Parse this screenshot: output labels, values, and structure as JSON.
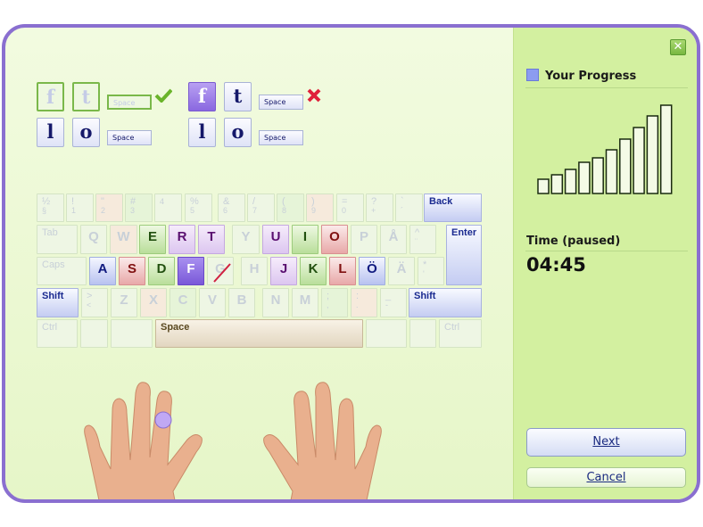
{
  "exercise": {
    "completed": {
      "row1": [
        "f",
        "t"
      ],
      "row1_space": "Space",
      "row2": [
        "l",
        "o"
      ],
      "row2_space": "Space",
      "status_icon": "checkmark-icon",
      "status_color": "#6ab42a"
    },
    "current": {
      "row1": [
        "f",
        "t"
      ],
      "row1_space": "Space",
      "row2": [
        "l",
        "o"
      ],
      "row2_space": "Space",
      "status_icon": "x-mark-icon",
      "status_color": "#e0203a"
    }
  },
  "keyboard": {
    "rows": [
      [
        {
          "t": "½",
          "s": "§",
          "c": "f"
        },
        {
          "t": "!",
          "s": "1",
          "c": "f"
        },
        {
          "t": "\"",
          "s": "2",
          "c": "f-pink"
        },
        {
          "t": "#",
          "s": "3",
          "c": "f-green"
        },
        {
          "t": "",
          "s": "4",
          "c": "f"
        },
        {
          "t": "%",
          "s": "5",
          "c": "f"
        },
        {
          "t": "&",
          "s": "6",
          "c": "f"
        },
        {
          "t": "/",
          "s": "7",
          "c": "f"
        },
        {
          "t": "(",
          "s": "8",
          "c": "f-green"
        },
        {
          "t": ")",
          "s": "9",
          "c": "f-pink"
        },
        {
          "t": "=",
          "s": "0",
          "c": "f"
        },
        {
          "t": "?",
          "s": "+",
          "c": "f"
        },
        {
          "t": "`",
          "s": "´",
          "c": "f"
        },
        {
          "t": "Back",
          "s": "",
          "c": "special"
        }
      ],
      [
        {
          "t": "Tab",
          "c": "f"
        },
        {
          "t": "Q",
          "c": "f",
          "l": 1
        },
        {
          "t": "W",
          "c": "f-pink",
          "l": 1
        },
        {
          "t": "E",
          "c": "green",
          "l": 1
        },
        {
          "t": "R",
          "c": "purple",
          "l": 1
        },
        {
          "t": "T",
          "c": "purple",
          "l": 1
        },
        {
          "t": "Y",
          "c": "f",
          "l": 1
        },
        {
          "t": "U",
          "c": "purple",
          "l": 1
        },
        {
          "t": "I",
          "c": "green",
          "l": 1
        },
        {
          "t": "O",
          "c": "red",
          "l": 1
        },
        {
          "t": "P",
          "c": "f",
          "l": 1
        },
        {
          "t": "Å",
          "c": "f",
          "l": 1
        },
        {
          "t": "^",
          "s": "¨",
          "c": "f"
        },
        {
          "t": "Enter",
          "c": "special"
        }
      ],
      [
        {
          "t": "Caps",
          "c": "f"
        },
        {
          "t": "A",
          "c": "blue",
          "l": 1
        },
        {
          "t": "S",
          "c": "red",
          "l": 1
        },
        {
          "t": "D",
          "c": "green",
          "l": 1
        },
        {
          "t": "F",
          "c": "pressed",
          "l": 1
        },
        {
          "t": "G",
          "c": "f",
          "l": 1,
          "x": 1
        },
        {
          "t": "H",
          "c": "f",
          "l": 1
        },
        {
          "t": "J",
          "c": "purple",
          "l": 1
        },
        {
          "t": "K",
          "c": "green",
          "l": 1
        },
        {
          "t": "L",
          "c": "red",
          "l": 1
        },
        {
          "t": "Ö",
          "c": "blue",
          "l": 1
        },
        {
          "t": "Ä",
          "c": "f",
          "l": 1
        },
        {
          "t": "*",
          "s": "'",
          "c": "f"
        }
      ],
      [
        {
          "t": "Shift",
          "c": "special"
        },
        {
          "t": ">",
          "s": "<",
          "c": "f"
        },
        {
          "t": "Z",
          "c": "f",
          "l": 1
        },
        {
          "t": "X",
          "c": "f-pink",
          "l": 1
        },
        {
          "t": "C",
          "c": "f-green",
          "l": 1
        },
        {
          "t": "V",
          "c": "f",
          "l": 1
        },
        {
          "t": "B",
          "c": "f",
          "l": 1
        },
        {
          "t": "N",
          "c": "f",
          "l": 1
        },
        {
          "t": "M",
          "c": "f",
          "l": 1
        },
        {
          "t": ";",
          "s": ",",
          "c": "f-green"
        },
        {
          "t": ":",
          "s": ".",
          "c": "f-pink"
        },
        {
          "t": "_",
          "s": "-",
          "c": "f"
        },
        {
          "t": "Shift",
          "c": "special"
        }
      ],
      [
        {
          "t": "Ctrl",
          "c": "f"
        },
        {
          "t": "",
          "c": "f"
        },
        {
          "t": "",
          "c": "f"
        },
        {
          "t": "Space",
          "c": "space"
        },
        {
          "t": "",
          "c": "f"
        },
        {
          "t": "",
          "c": "f"
        },
        {
          "t": "Ctrl",
          "c": "f"
        }
      ]
    ]
  },
  "sidebar": {
    "close_icon": "close-icon",
    "progress_title": "Your Progress",
    "progress_icon": "bar-chart-icon",
    "progress_levels": [
      16,
      21,
      27,
      35,
      40,
      49,
      61,
      74,
      87,
      99
    ],
    "time_label": "Time (paused)",
    "time_value": "04:45",
    "next_label": "Next",
    "cancel_label": "Cancel"
  },
  "colors": {
    "frame": "#8a6fd0",
    "sidebar": "#d3f0a0",
    "active_finger": "#c0a8f4"
  }
}
